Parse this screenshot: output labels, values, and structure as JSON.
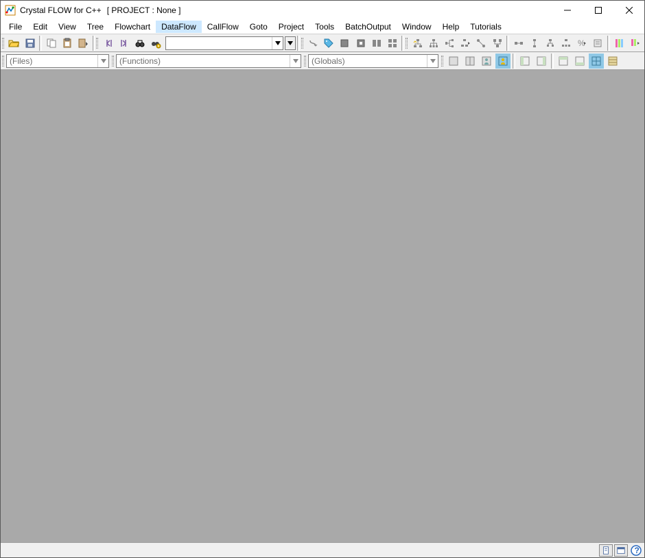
{
  "title": "Crystal FLOW for C++",
  "project_label": "[ PROJECT : None ]",
  "menus": [
    "File",
    "Edit",
    "View",
    "Tree",
    "Flowchart",
    "DataFlow",
    "CallFlow",
    "Goto",
    "Project",
    "Tools",
    "BatchOutput",
    "Window",
    "Help",
    "Tutorials"
  ],
  "active_menu": "DataFlow",
  "search_combo": "",
  "combos": {
    "files": "(Files)",
    "functions": "(Functions)",
    "globals": "(Globals)"
  }
}
